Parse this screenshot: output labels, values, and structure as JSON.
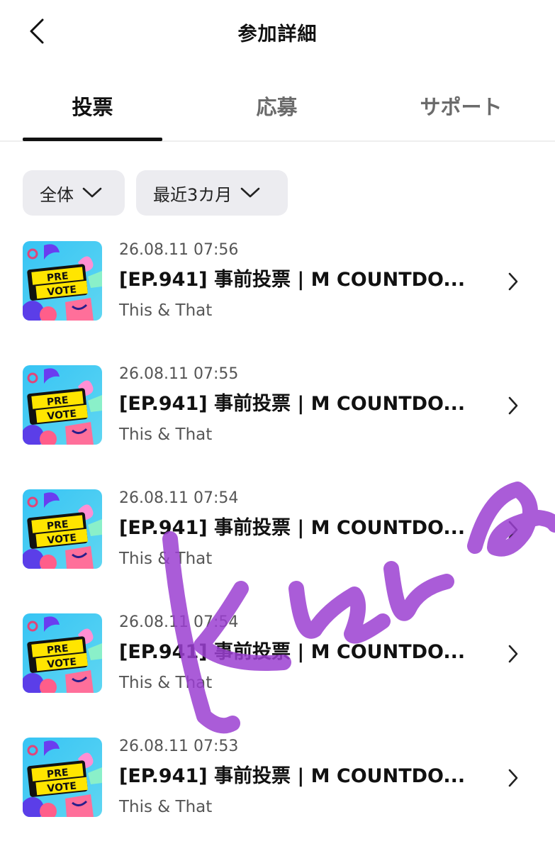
{
  "header": {
    "title": "参加詳細",
    "back_icon": "chevron-left-icon"
  },
  "tabs": [
    {
      "label": "投票",
      "active": true
    },
    {
      "label": "応募",
      "active": false
    },
    {
      "label": "サポート",
      "active": false
    }
  ],
  "filters": {
    "category": {
      "value": "全体",
      "icon": "chevron-down-icon"
    },
    "period": {
      "value": "最近3カ月",
      "icon": "chevron-down-icon"
    }
  },
  "thumbnail": {
    "line1": "PRE",
    "line2": "VOTE"
  },
  "items": [
    {
      "date": "26.08.11 07:56",
      "title": "[EP.941] 事前投票 | M COUNTDO...",
      "subtitle": "This & That"
    },
    {
      "date": "26.08.11 07:55",
      "title": "[EP.941] 事前投票 | M COUNTDO...",
      "subtitle": "This & That"
    },
    {
      "date": "26.08.11 07:54",
      "title": "[EP.941] 事前投票 | M COUNTDO...",
      "subtitle": "This & That"
    },
    {
      "date": "26.08.11 07:54",
      "title": "[EP.941] 事前投票 | M COUNTDO...",
      "subtitle": "This & That"
    },
    {
      "date": "26.08.11 07:53",
      "title": "[EP.941] 事前投票 | M COUNTDO...",
      "subtitle": "This & That"
    }
  ],
  "colors": {
    "accent": "#111111",
    "muted": "#555555",
    "filter_bg": "#ececf0",
    "scribble": "#9b3fd1",
    "thumb_bg": "#3ec6f0",
    "thumb_label_bg": "#ffe500"
  }
}
